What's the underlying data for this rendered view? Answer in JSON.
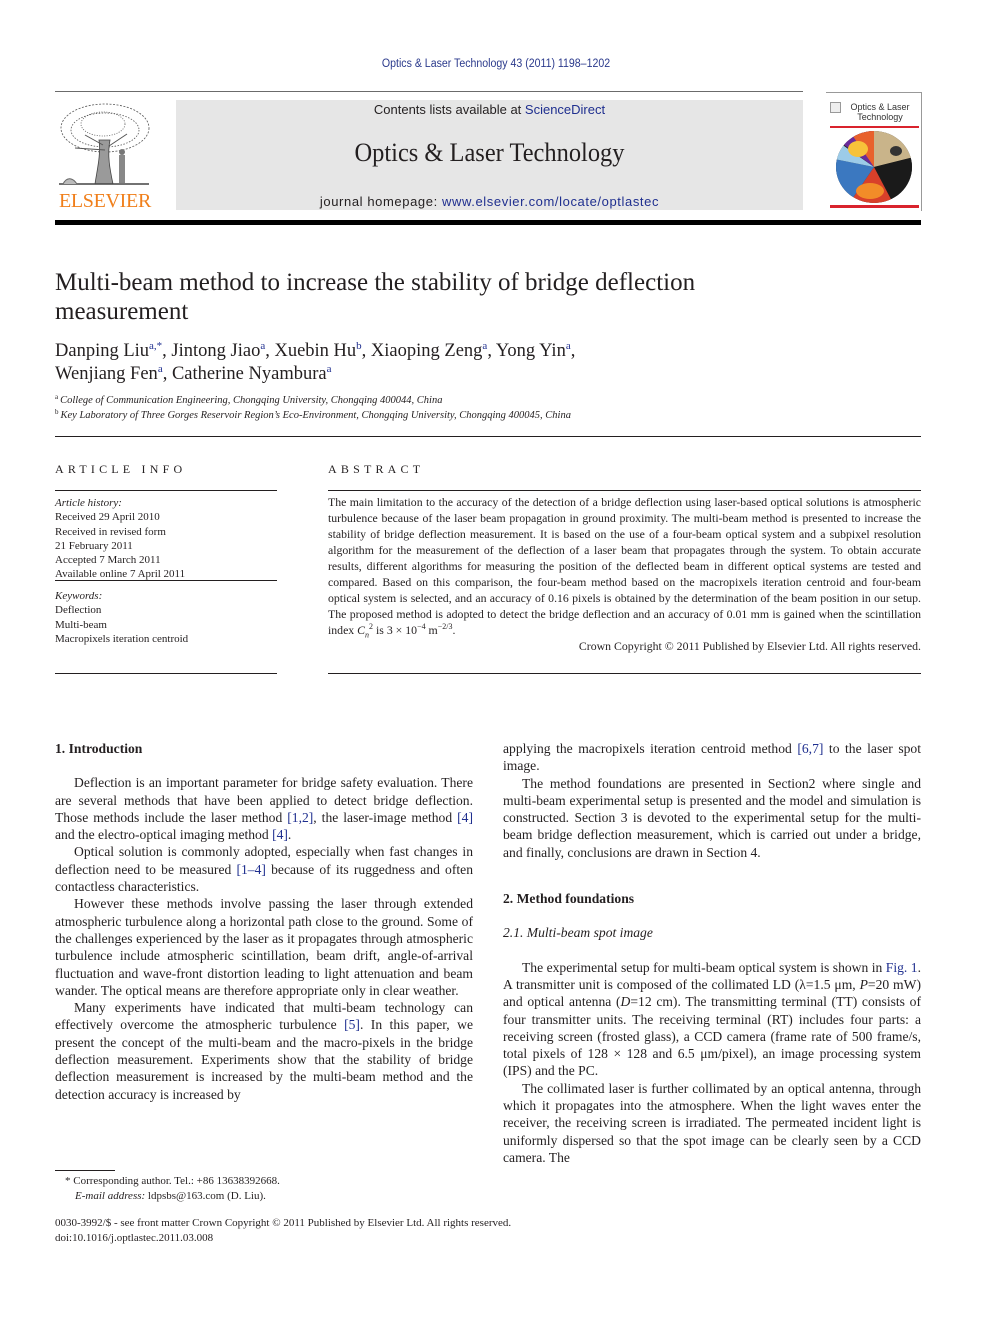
{
  "running_head": "Optics & Laser Technology 43 (2011) 1198–1202",
  "masthead": {
    "publisher_logo_text": "ELSEVIER",
    "contents_prefix": "Contents lists available at ",
    "contents_link": "ScienceDirect",
    "journal_title": "Optics & Laser Technology",
    "homepage_prefix": "journal homepage: ",
    "homepage_link": "www.elsevier.com/locate/optlastec",
    "cover_title": "Optics & Laser Technology",
    "colors": {
      "publisher_orange": "#f07f1b",
      "link_blue": "#1f2f8f",
      "banner_gray": "#e6e6e6",
      "cover_red": "#d9232d"
    }
  },
  "article": {
    "title": "Multi-beam method to increase the stability of bridge deflection measurement",
    "authors": [
      {
        "name": "Danping Liu",
        "sup": "a,*",
        "sep": ", "
      },
      {
        "name": "Jintong Jiao",
        "sup": "a",
        "sep": ", "
      },
      {
        "name": "Xuebin Hu",
        "sup": "b",
        "sep": ", "
      },
      {
        "name": "Xiaoping Zeng",
        "sup": "a",
        "sep": ", "
      },
      {
        "name": "Yong Yin",
        "sup": "a",
        "sep": ","
      },
      {
        "name": "Wenjiang Fen",
        "sup": "a",
        "sep": ", "
      },
      {
        "name": "Catherine Nyambura",
        "sup": "a",
        "sep": ""
      }
    ],
    "affiliations": [
      {
        "mark": "a",
        "text": "College of Communication Engineering, Chongqing University, Chongqing 400044, China"
      },
      {
        "mark": "b",
        "text": "Key Laboratory of Three Gorges Reservoir Region’s Eco-Environment, Chongqing University, Chongqing 400045, China"
      }
    ]
  },
  "article_info": {
    "heading": "ARTICLE INFO",
    "history_label": "Article history:",
    "history": [
      "Received 29 April 2010",
      "Received in revised form",
      "21 February 2011",
      "Accepted 7 March 2011",
      "Available online 7 April 2011"
    ],
    "keywords_label": "Keywords:",
    "keywords": [
      "Deflection",
      "Multi-beam",
      "Macropixels iteration centroid"
    ]
  },
  "abstract": {
    "heading": "ABSTRACT",
    "text_main": "The main limitation to the accuracy of the detection of a bridge deflection using laser-based optical solutions is atmospheric turbulence because of the laser beam propagation in ground proximity. The multi-beam method is presented to increase the stability of bridge deflection measurement. It is based on the use of a four-beam optical system and a subpixel resolution algorithm for the measurement of the deflection of a laser beam that propagates through the system. To obtain accurate results, different algorithms for measuring the position of the deflected beam in different optical systems are tested and compared. Based on this comparison, the four-beam method based on the macropixels iteration centroid and four-beam optical system is selected, and an accuracy of 0.16 pixels is obtained by the determination of the beam position in our setup. The proposed method is adopted to detect the bridge deflection and an accuracy of 0.01 mm is gained when the scintillation index ",
    "symbol": "C",
    "symbol_sub": "n",
    "symbol_sup": "2",
    "text_mid": " is 3 × 10",
    "exp1": "−4",
    "text_unit": " m",
    "exp2": "−2/3",
    "text_end": ".",
    "copyright": "Crown Copyright © 2011 Published by Elsevier Ltd. All rights reserved."
  },
  "body": {
    "sec1_heading": "1.  Introduction",
    "sec1_p1": [
      {
        "t": "Deflection is an important parameter for bridge safety evaluation. There are several methods that have been applied to detect bridge deflection. Those methods include the laser method "
      },
      {
        "l": "[1,2]"
      },
      {
        "t": ", the laser-image method "
      },
      {
        "l": "[4]"
      },
      {
        "t": " and the electro-optical imaging method "
      },
      {
        "l": "[4]"
      },
      {
        "t": "."
      }
    ],
    "sec1_p2": [
      {
        "t": "Optical solution is commonly adopted, especially when fast changes in deflection need to be measured "
      },
      {
        "l": "[1–4]"
      },
      {
        "t": " because of its ruggedness and often contactless characteristics."
      }
    ],
    "sec1_p3": [
      {
        "t": "However these methods involve passing the laser through extended atmospheric turbulence along a horizontal path close to the ground. Some of the challenges experienced by the laser as it propagates through atmospheric turbulence include atmospheric scintillation, beam drift, angle-of-arrival fluctuation and wave-front distortion leading to light attenuation and beam wander. The optical means are therefore appropriate only in clear weather."
      }
    ],
    "sec1_p4": [
      {
        "t": "Many experiments have indicated that multi-beam technology can effectively overcome the atmospheric turbulence "
      },
      {
        "l": "[5]"
      },
      {
        "t": ". In this paper, we present the concept of the multi-beam and the macro-pixels in the bridge deflection measurement. Experiments show that the stability of bridge deflection measurement is increased by the multi-beam method and the detection accuracy is increased by"
      }
    ],
    "col2_p1": [
      {
        "t": "applying the macropixels iteration centroid method "
      },
      {
        "l": "[6,7]"
      },
      {
        "t": " to the laser spot image."
      }
    ],
    "col2_p2": [
      {
        "t": "The method foundations are presented in Section2 where single and multi-beam experimental setup is presented and the model and simulation is constructed. Section 3 is devoted to the experimental setup for the multi-beam bridge deflection measurement, which is carried out under a bridge, and finally, conclusions are drawn in Section 4."
      }
    ],
    "sec2_heading": "2.  Method foundations",
    "sec21_heading": "2.1.  Multi-beam spot image",
    "sec21_p1": [
      {
        "t": "The experimental setup for multi-beam optical system is shown in "
      },
      {
        "l": "Fig. 1"
      },
      {
        "t": ". A transmitter unit is composed of the collimated LD (λ=1.5 μm, "
      },
      {
        "i": "P"
      },
      {
        "t": "=20 mW) and optical antenna ("
      },
      {
        "i": "D"
      },
      {
        "t": "=12 cm). The transmitting terminal (TT) consists of four transmitter units. The receiving terminal (RT) includes four parts: a receiving screen (frosted glass), a CCD camera (frame rate of 500 frame/s, total pixels of 128 × 128 and 6.5 μm/pixel), an image processing system (IPS) and the PC."
      }
    ],
    "sec21_p2": [
      {
        "t": "The collimated laser is further collimated by an optical antenna, through which it propagates into the atmosphere. When the light waves enter the receiver, the receiving screen is irradiated. The permeated incident light is uniformly dispersed so that the spot image can be clearly seen by a CCD camera. The"
      }
    ]
  },
  "footnotes": {
    "corresponding": "* Corresponding author. Tel.: +86 13638392668.",
    "email_label": "E-mail address:",
    "email_value": " ldpsbs@163.com (D. Liu)."
  },
  "footer": {
    "line1": "0030-3992/$ - see front matter Crown Copyright © 2011 Published by Elsevier Ltd. All rights reserved.",
    "line2": "doi:10.1016/j.optlastec.2011.03.008"
  }
}
